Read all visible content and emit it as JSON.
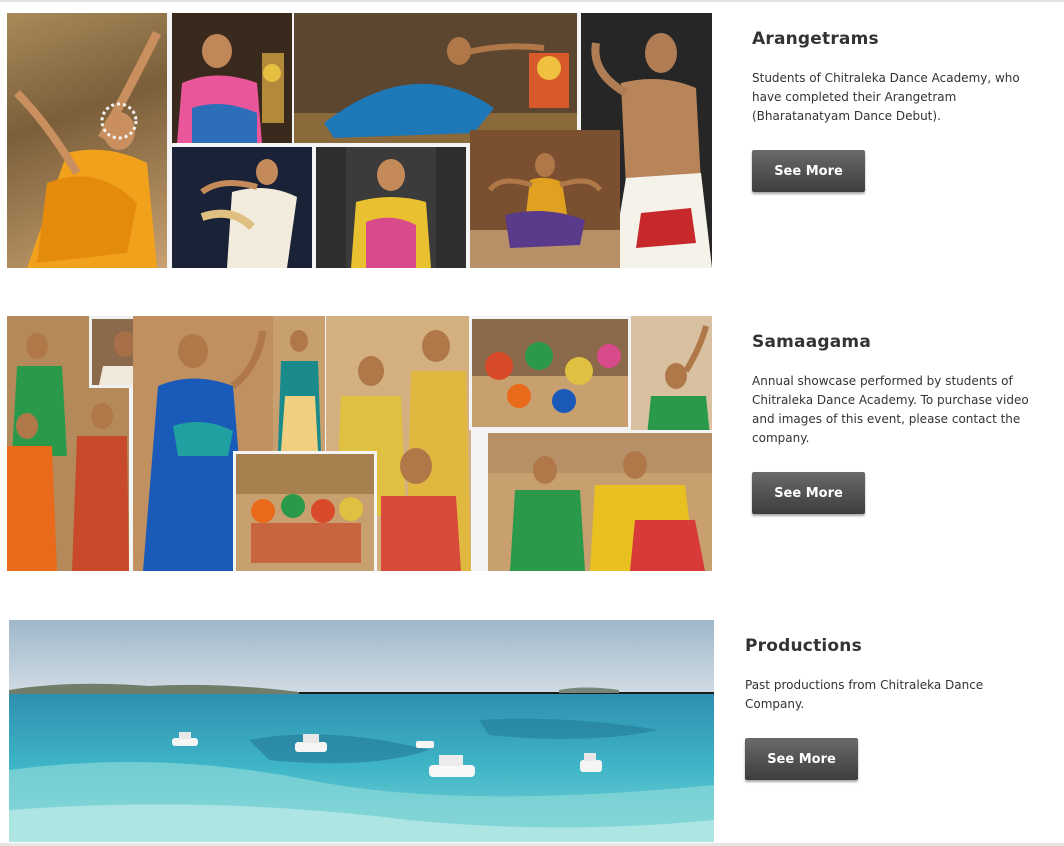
{
  "sections": [
    {
      "title": "Arangetrams",
      "description": "Students of Chitraleka Dance Academy, who have completed their Arangetram (Bharatanatyam Dance Debut).",
      "button_label": "See More"
    },
    {
      "title": "Samaagama",
      "description": "Annual showcase performed by students of Chitraleka Dance Academy. To purchase video and images of this event, please contact the company.",
      "button_label": "See More"
    },
    {
      "title": "Productions",
      "description": "Past productions from Chitraleka Dance Company.",
      "button_label": "See More"
    }
  ]
}
